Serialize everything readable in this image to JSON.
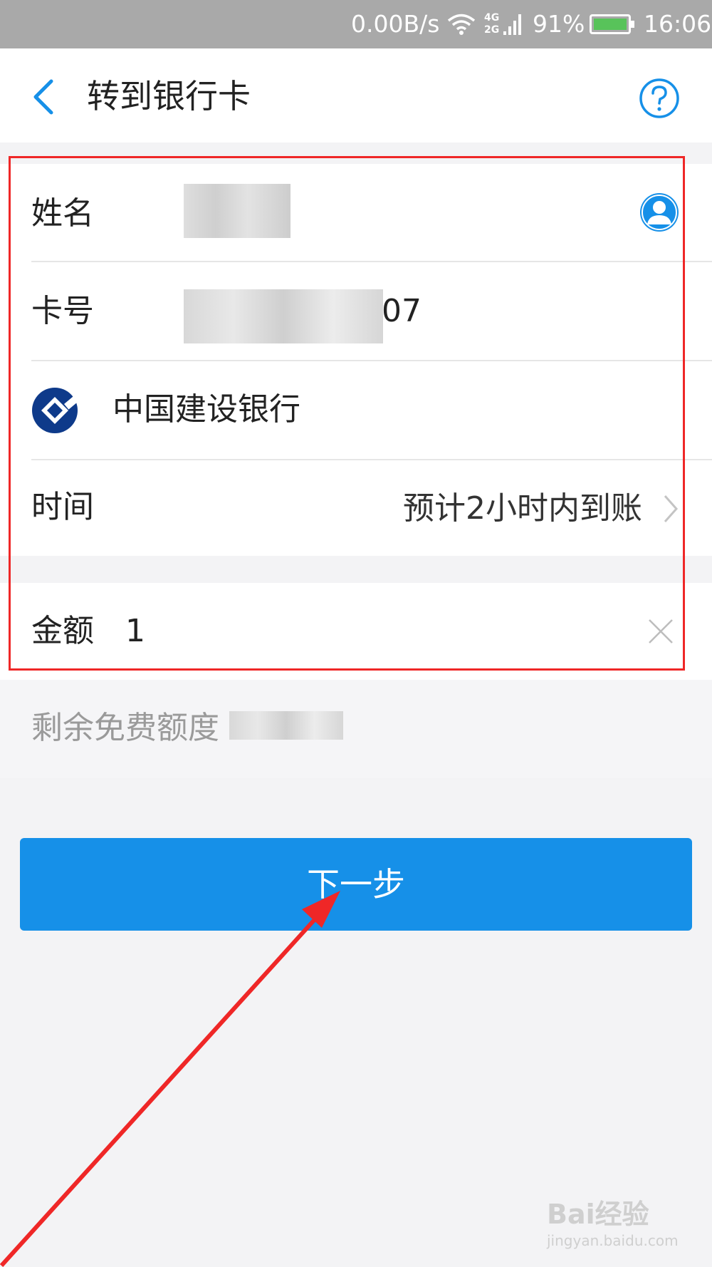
{
  "status_bar": {
    "speed": "0.00B/s",
    "network": "4G\n2G",
    "battery_percent": "91%",
    "battery_level": 0.91,
    "time": "16:06"
  },
  "header": {
    "title": "转到银行卡"
  },
  "form": {
    "name_label": "姓名",
    "card_label": "卡号",
    "card_value_suffix": "07",
    "bank_name": "中国建设银行",
    "time_label": "时间",
    "time_value": "预计2小时内到账",
    "amount_label": "金额",
    "amount_value": "1",
    "free_quota_label": "剩余免费额度"
  },
  "actions": {
    "next_label": "下一步"
  },
  "watermark": {
    "brand": "Bai经验",
    "url": "jingyan.baidu.com"
  },
  "colors": {
    "accent": "#1690e8",
    "annotation": "#ef2727",
    "bank_logo": "#0e3a8a"
  }
}
